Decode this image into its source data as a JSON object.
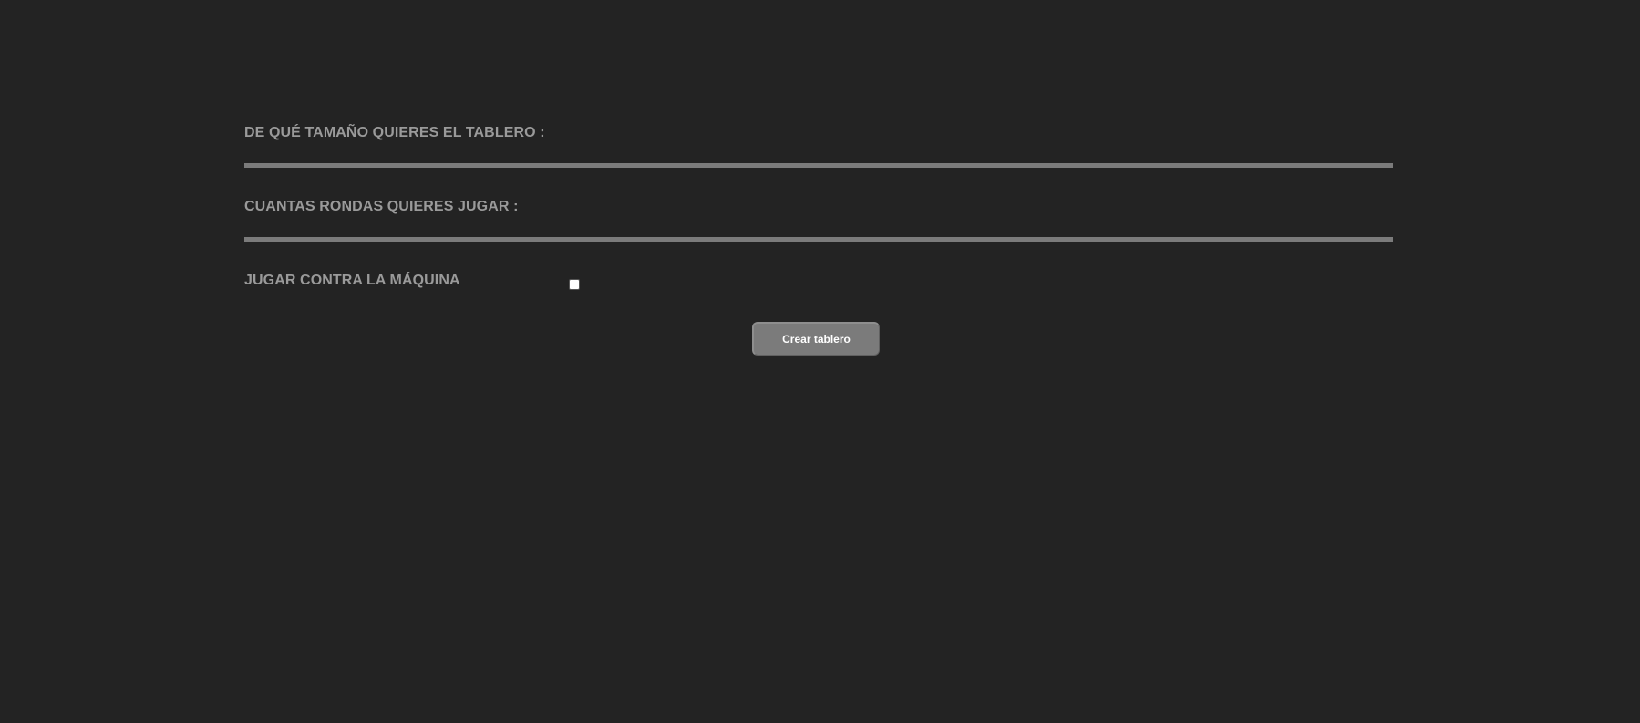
{
  "form": {
    "board_size_label": "DE QUÉ TAMAÑO QUIERES EL TABLERO :",
    "board_size_value": "",
    "rounds_label": "CUANTAS RONDAS QUIERES JUGAR :",
    "rounds_value": "",
    "vs_machine_label": "JUGAR CONTRA LA MÁQUINA",
    "vs_machine_checked": false,
    "submit_label": "Crear tablero"
  },
  "colors": {
    "background": "#232323",
    "label_text": "#9a9a9a",
    "input_underline": "#7b7b7b",
    "button_bg": "#7b7b7b",
    "button_text": "#ffffff"
  }
}
